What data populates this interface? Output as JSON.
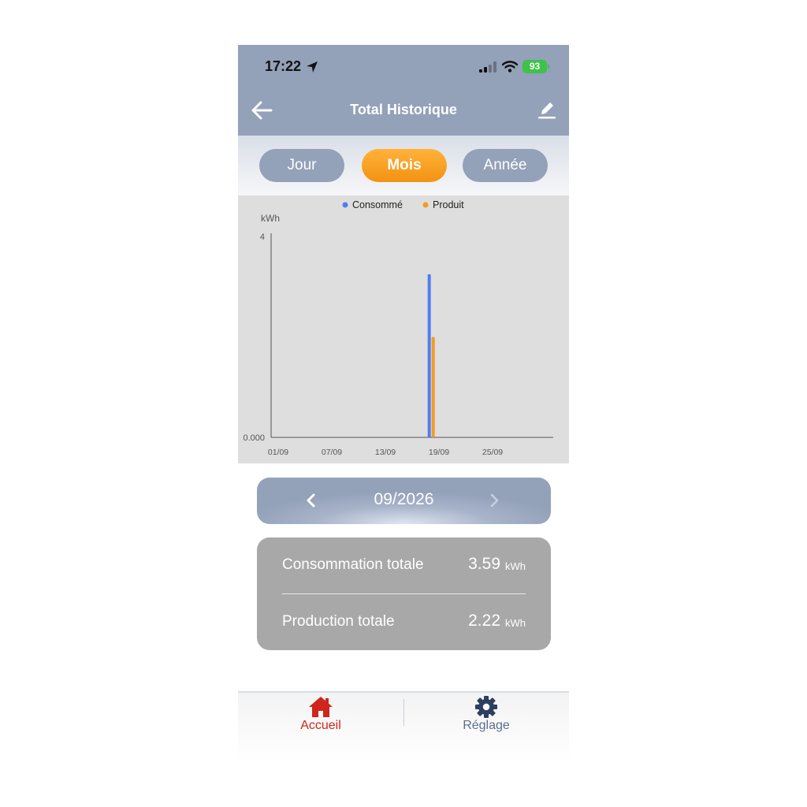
{
  "status_bar": {
    "time": "17:22",
    "battery": "93"
  },
  "header": {
    "title": "Total Historique"
  },
  "segments": [
    {
      "label": "Jour",
      "active": false
    },
    {
      "label": "Mois",
      "active": true
    },
    {
      "label": "Année",
      "active": false
    }
  ],
  "chart_data": {
    "type": "bar",
    "ylabel": "kWh",
    "ylim": [
      0,
      4
    ],
    "y_ticks": [
      "4",
      "0.000"
    ],
    "x_tick_labels": [
      "01/09",
      "07/09",
      "13/09",
      "19/09",
      "25/09"
    ],
    "x_range_days": [
      1,
      31
    ],
    "legend_position": "top",
    "series": [
      {
        "name": "Consommé",
        "color": "#4f7ef0",
        "points": [
          {
            "day": 18,
            "value": 3.25
          }
        ]
      },
      {
        "name": "Produit",
        "color": "#f49a24",
        "points": [
          {
            "day": 18,
            "value": 2.0
          }
        ]
      }
    ],
    "grid": false
  },
  "month_nav": {
    "label": "09/2026"
  },
  "totals": {
    "consumption_label": "Consommation totale",
    "consumption_value": "3.59",
    "production_label": "Production totale",
    "production_value": "2.22",
    "unit": "kWh"
  },
  "tabbar": {
    "home_label": "Accueil",
    "settings_label": "Réglage",
    "home_color": "#d0251b",
    "settings_color": "#5a6e93"
  }
}
